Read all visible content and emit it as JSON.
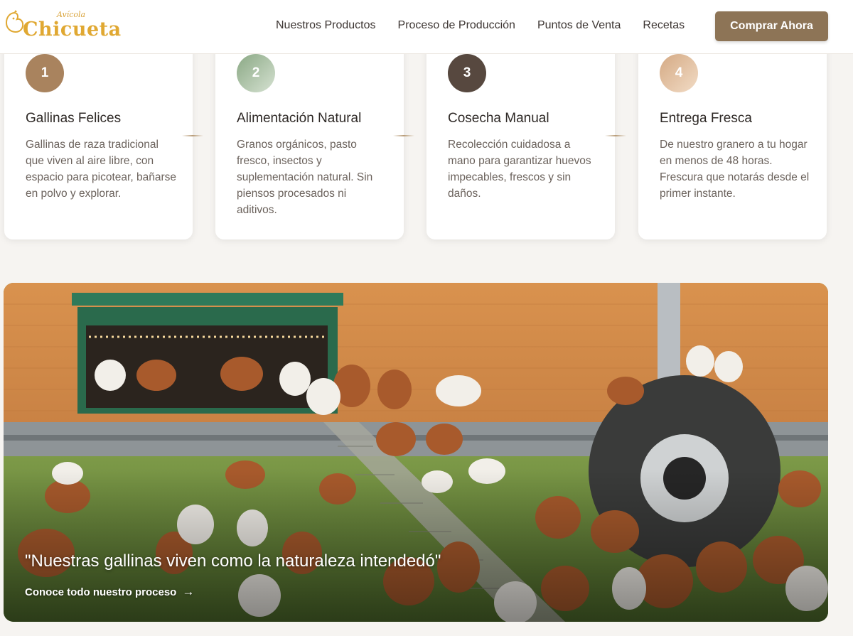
{
  "brand": {
    "small": "Avícola",
    "name": "Chicueta",
    "accent": "#e0a832"
  },
  "nav": {
    "items": [
      {
        "label": "Nuestros Productos"
      },
      {
        "label": "Proceso de Producción"
      },
      {
        "label": "Puntos de Venta"
      },
      {
        "label": "Recetas"
      }
    ],
    "cta_label": "Comprar Ahora",
    "cta_color": "#8d7456"
  },
  "steps": [
    {
      "number": "1",
      "title": "Gallinas Felices",
      "text": "Gallinas de raza tradicional que viven al aire libre, con espacio para picotear, bañarse en polvo y explorar.",
      "color": "#a9835e"
    },
    {
      "number": "2",
      "title": "Alimentación Natural",
      "text": "Granos orgánicos, pasto fresco, insectos y suplementación natural. Sin piensos procesados ni aditivos.",
      "color": "#9fb59a"
    },
    {
      "number": "3",
      "title": "Cosecha Manual",
      "text": "Recolección cuidadosa a mano para garantizar huevos impecables, frescos y sin daños.",
      "color": "#57483f"
    },
    {
      "number": "4",
      "title": "Entrega Fresca",
      "text": "De nuestro granero a tu hogar en menos de 48 horas. Frescura que notarás desde el primer instante.",
      "color": "#ddb792"
    }
  ],
  "hero": {
    "quote": "\"Nuestras gallinas viven como la naturaleza intendedó\"",
    "cta_label": "Conoce todo nuestro proceso",
    "cta_icon": "arrow-right-icon"
  }
}
